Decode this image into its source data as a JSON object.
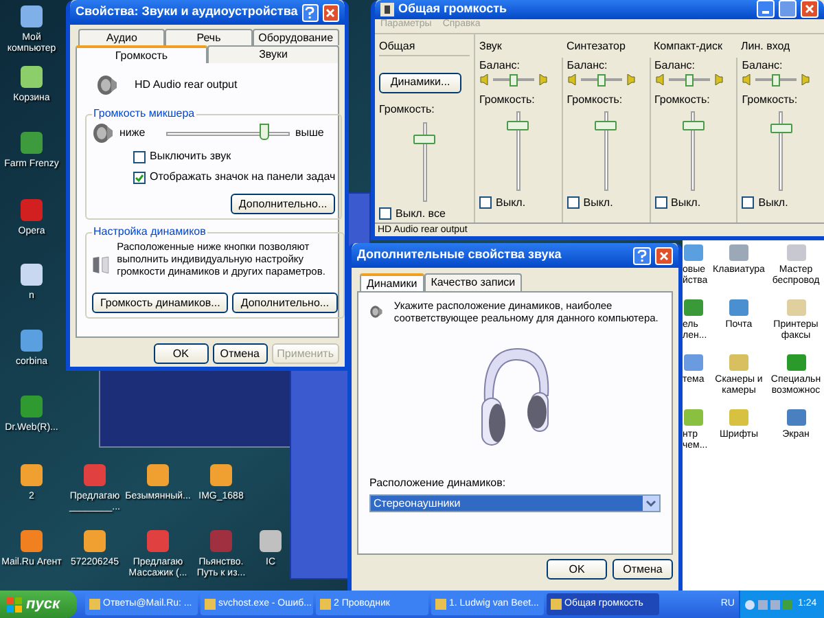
{
  "desktop_icons": [
    {
      "label": "Мой компьютер"
    },
    {
      "label": "Корзина"
    },
    {
      "label": "Farm Frenzy"
    },
    {
      "label": "Opera"
    },
    {
      "label": "n"
    },
    {
      "label": "corbina"
    },
    {
      "label": "Dr.Web(R)..."
    },
    {
      "label": "2"
    },
    {
      "label": "Предлагаю ________..."
    },
    {
      "label": "Безымянный..."
    },
    {
      "label": "IMG_1688"
    },
    {
      "label": "Mail.Ru Агент"
    },
    {
      "label": "572206245"
    },
    {
      "label": "Предлагаю Массажик (..."
    },
    {
      "label": "Пьянство. Путь к из..."
    },
    {
      "label": "IC"
    }
  ],
  "sound_properties": {
    "title": "Свойства: Звуки и аудиоустройства",
    "tabs_back": [
      {
        "label": "Аудио",
        "selected": false
      },
      {
        "label": "Речь",
        "selected": false
      },
      {
        "label": "Оборудование",
        "selected": false
      }
    ],
    "tabs": [
      {
        "label": "Громкость",
        "selected": true
      },
      {
        "label": "Звуки",
        "selected": false
      }
    ],
    "device": "HD Audio rear output",
    "mixer_group": {
      "title": "Громкость микшера",
      "low": "ниже",
      "high": "выше",
      "level": 0.82,
      "options": [
        {
          "label": "Выключить звук",
          "checked": false
        },
        {
          "label": "Отображать значок на панели задач",
          "checked": true
        }
      ],
      "button": "Дополнительно..."
    },
    "speakers_group": {
      "title": "Настройка динамиков",
      "text": "Расположенные ниже кнопки позволяют выполнить индивидуальную настройку громкости динамиков и других параметров.",
      "buttons": [
        "Громкость динамиков...",
        "Дополнительно..."
      ]
    },
    "buttons": [
      {
        "label": "OK",
        "disabled": false
      },
      {
        "label": "Отмена",
        "disabled": false
      },
      {
        "label": "Применить",
        "disabled": true
      }
    ]
  },
  "volume_control": {
    "title": "Общая громкость",
    "menu": [
      "Параметры",
      "Справка"
    ],
    "master": {
      "name": "Общая",
      "button": "Динамики...",
      "volume_label": "Громкость:",
      "level": 0.82,
      "mute": {
        "label": "Выкл. все",
        "checked": false
      }
    },
    "channels": [
      {
        "name": "Звук",
        "balance": {
          "label": "Баланс:",
          "level": 0.5
        },
        "volume": {
          "label": "Громкость:",
          "level": 0.85
        },
        "mute": {
          "label": "Выкл.",
          "checked": false
        }
      },
      {
        "name": "Синтезатор",
        "balance": {
          "label": "Баланс:",
          "level": 0.5
        },
        "volume": {
          "label": "Громкость:",
          "level": 0.85
        },
        "mute": {
          "label": "Выкл.",
          "checked": false
        }
      },
      {
        "name": "Компакт-диск",
        "balance": {
          "label": "Баланс:",
          "level": 0.5
        },
        "volume": {
          "label": "Громкость:",
          "level": 0.85
        },
        "mute": {
          "label": "Выкл.",
          "checked": false
        }
      },
      {
        "name": "Лин. вход",
        "balance": {
          "label": "Баланс:",
          "level": 0.5
        },
        "volume": {
          "label": "Громкость:",
          "level": 0.82
        },
        "mute": {
          "label": "Выкл.",
          "checked": false
        }
      }
    ],
    "status": "HD Audio rear output"
  },
  "control_panel": {
    "items": [
      {
        "lines": [
          "овые",
          "йства"
        ]
      },
      {
        "lines": [
          "Клавиатура"
        ]
      },
      {
        "lines": [
          "Мастер",
          "беспровод"
        ]
      },
      {
        "lines": [
          "ель",
          "лен..."
        ]
      },
      {
        "lines": [
          "Почта"
        ]
      },
      {
        "lines": [
          "Принтеры",
          "факсы"
        ]
      },
      {
        "lines": [
          "тема"
        ]
      },
      {
        "lines": [
          "Сканеры и",
          "камеры"
        ]
      },
      {
        "lines": [
          "Специальн",
          "возможнос"
        ]
      },
      {
        "lines": [
          "нтр",
          "чем..."
        ]
      },
      {
        "lines": [
          "Шрифты"
        ]
      },
      {
        "lines": [
          "Экран"
        ]
      }
    ]
  },
  "advanced_dialog": {
    "title": "Дополнительные свойства звука",
    "tabs": [
      {
        "label": "Динамики",
        "selected": true
      },
      {
        "label": "Качество записи",
        "selected": false
      }
    ],
    "text": "Укажите расположение динамиков, наиболее соответствующее реальному для данного компьютера.",
    "select_label": "Расположение динамиков:",
    "select_value": "Стереонаушники",
    "buttons": [
      "OK",
      "Отмена"
    ]
  },
  "taskbar": {
    "start": "пуск",
    "tasks": [
      {
        "label": "Ответы@Mail.Ru: ...",
        "selected": false
      },
      {
        "label": "svchost.exe - Ошиб...",
        "selected": false
      },
      {
        "label": "2 Проводник",
        "selected": false
      },
      {
        "label": "1. Ludwig van Beet...",
        "selected": false
      },
      {
        "label": "Общая громкость",
        "selected": true
      }
    ],
    "language": "RU",
    "time": "1:24"
  }
}
